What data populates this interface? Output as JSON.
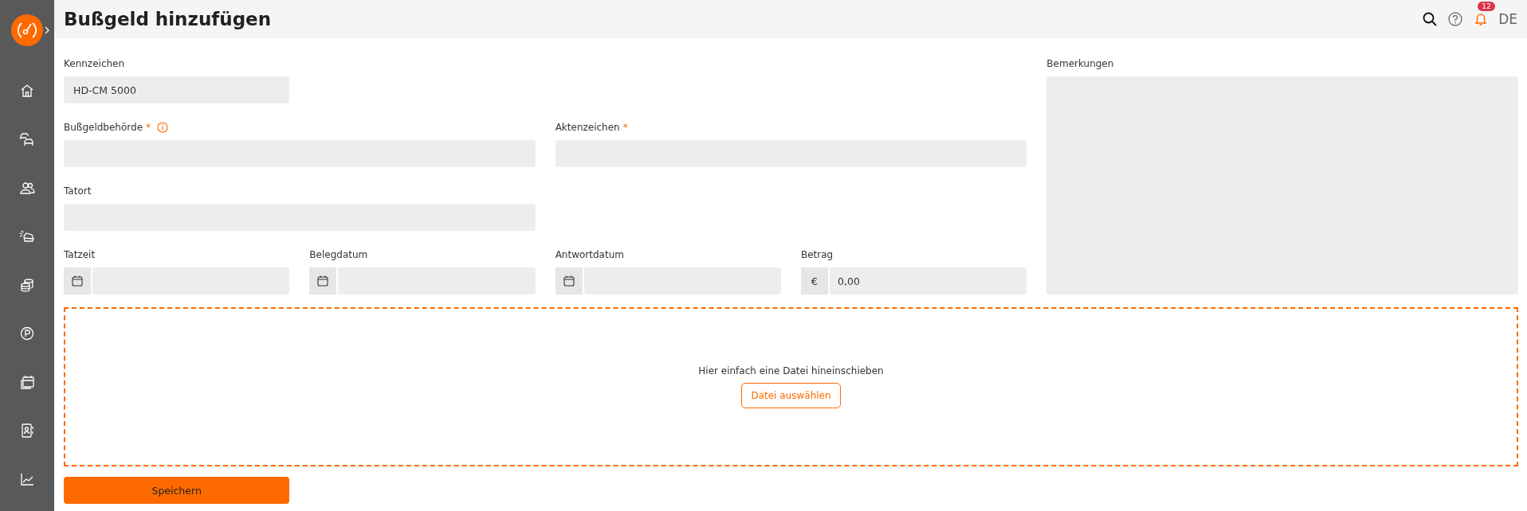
{
  "sidebar": {
    "items": [
      {
        "kind": "home"
      },
      {
        "kind": "cars"
      },
      {
        "kind": "people"
      },
      {
        "kind": "damage"
      },
      {
        "kind": "coins"
      },
      {
        "kind": "parking"
      },
      {
        "kind": "calendar"
      },
      {
        "kind": "contacts"
      },
      {
        "kind": "chart"
      }
    ]
  },
  "header": {
    "title": "Bußgeld hinzufügen",
    "notifications": "12",
    "language": "DE"
  },
  "fields": [
    {
      "label": "Kennzeichen",
      "kind": "text",
      "value": "HD-CM 5000"
    },
    {
      "label": "Bußgeldbehörde",
      "kind": "text",
      "required_mark": "*",
      "info": true
    },
    {
      "label": "Aktenzeichen",
      "kind": "text",
      "required_mark": "*"
    },
    {
      "label": "Tatort",
      "kind": "text"
    },
    {
      "label": "Tatzeit",
      "kind": "date"
    },
    {
      "label": "Belegdatum",
      "kind": "date"
    },
    {
      "label": "Antwortdatum",
      "kind": "date"
    },
    {
      "label": "Betrag",
      "kind": "currency",
      "prefix": "€",
      "value": "0,00"
    }
  ],
  "remarks": {
    "label": "Bemerkungen"
  },
  "dropzone": {
    "text": "Hier einfach eine Datei hineinschieben",
    "button": "Datei auswählen"
  },
  "save_button": "Speichern"
}
